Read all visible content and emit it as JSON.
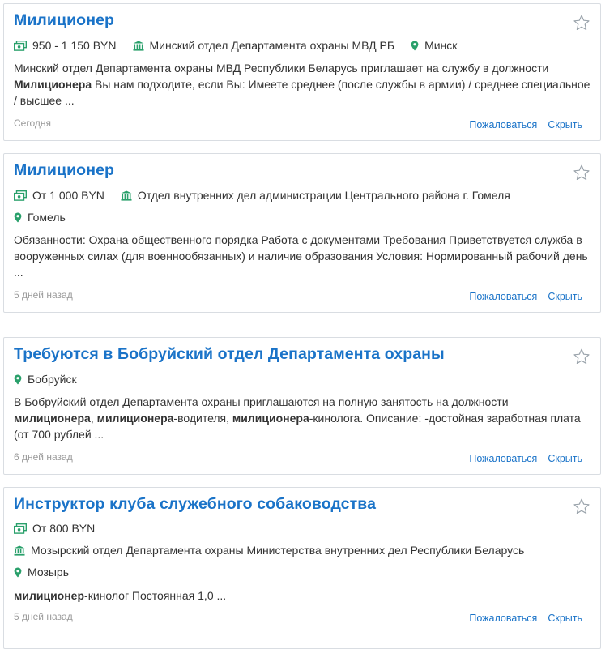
{
  "vacancies": [
    {
      "title": "Милиционер",
      "salary": "950 - 1 150 BYN",
      "company": "Минский отдел Департамента охраны МВД РБ",
      "city": "Минск",
      "desc": [
        {
          "t": "Минский отдел Департамента охраны МВД Республики Беларусь приглашает на службу в должности ",
          "b": false
        },
        {
          "t": "Милиционера",
          "b": true
        },
        {
          "t": " Вы нам подходите, если Вы: Имеете среднее (после службы в армии) / среднее специальное / высшее ...",
          "b": false
        }
      ],
      "date": "Сегодня",
      "complain": "Пожаловаться",
      "hide": "Скрыть"
    },
    {
      "title": "Милиционер",
      "salary": "От 1 000 BYN",
      "company": "Отдел внутренних дел администрации Центрального района г. Гомеля",
      "city": "Гомель",
      "desc": [
        {
          "t": "Обязанности: Охрана общественного порядка Работа с документами Требования Приветствуется служба в вооруженных силах (для военнообязанных) и наличие образования Условия: Нормированный рабочий день ...",
          "b": false
        }
      ],
      "date": "5 дней назад",
      "complain": "Пожаловаться",
      "hide": "Скрыть"
    },
    {
      "title": "Требуются в Бобруйский отдел Департамента охраны",
      "city": "Бобруйск",
      "desc": [
        {
          "t": "В Бобруйский отдел Департамента охраны приглашаются на полную занятость на должности ",
          "b": false
        },
        {
          "t": "милиционера",
          "b": true
        },
        {
          "t": ", ",
          "b": false
        },
        {
          "t": "милиционера",
          "b": true
        },
        {
          "t": "-водителя, ",
          "b": false
        },
        {
          "t": "милиционера",
          "b": true
        },
        {
          "t": "-кинолога. Описание: -достойная заработная плата (от 700 рублей ...",
          "b": false
        }
      ],
      "date": "6 дней назад",
      "complain": "Пожаловаться",
      "hide": "Скрыть"
    },
    {
      "title": "Инструктор клуба служебного собаководства",
      "salary": "От 800 BYN",
      "company": "Мозырский отдел Департамента охраны Министерства внутренних дел Республики Беларусь",
      "city": "Мозырь",
      "desc": [
        {
          "t": "милиционер",
          "b": true
        },
        {
          "t": "-кинолог Постоянная 1,0 ...",
          "b": false
        }
      ],
      "date": "5 дней назад",
      "complain": "Пожаловаться",
      "hide": "Скрыть"
    }
  ],
  "colors": {
    "accent": "#1a73c8",
    "icon": "#2aa06b",
    "muted": "#9a9a9a",
    "border": "#d9dde2"
  },
  "icons": {
    "salary": "money-icon",
    "company": "building-icon",
    "city": "location-pin-icon",
    "favorite": "star-icon"
  }
}
